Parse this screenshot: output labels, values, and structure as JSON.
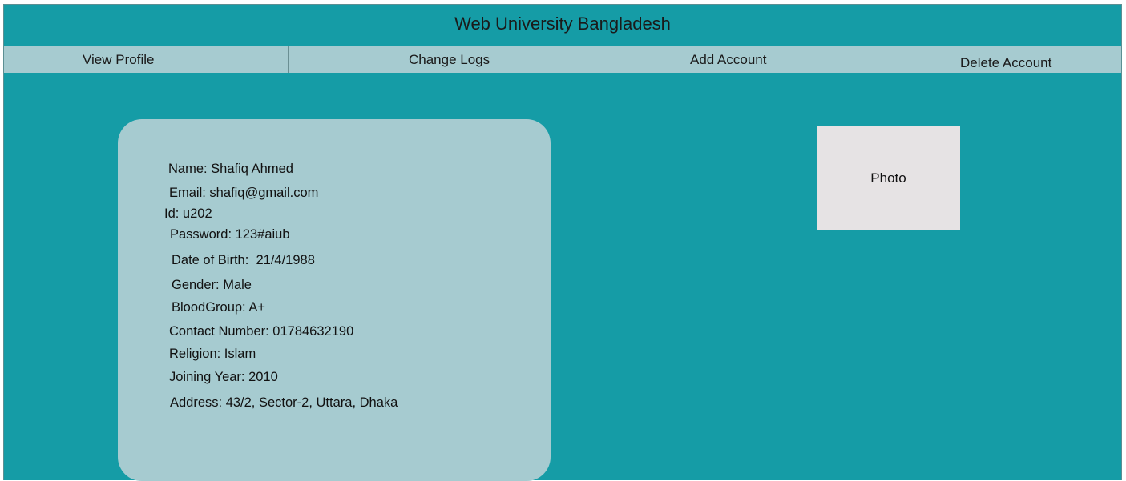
{
  "header": {
    "title": "Web University Bangladesh"
  },
  "nav": {
    "items": [
      {
        "label": "View Profile"
      },
      {
        "label": "Change Logs"
      },
      {
        "label": "Add Account"
      },
      {
        "label": "Delete Account"
      }
    ]
  },
  "profile": {
    "fields": [
      {
        "text": "Name: Shafiq Ahmed"
      },
      {
        "text": "Email: shafiq@gmail.com"
      },
      {
        "text": "Id: u202"
      },
      {
        "text": "Password: 123#aiub"
      },
      {
        "text": "Date of Birth:  21/4/1988"
      },
      {
        "text": "Gender: Male"
      },
      {
        "text": "BloodGroup: A+"
      },
      {
        "text": "Contact Number: 01784632190"
      },
      {
        "text": "Religion: Islam"
      },
      {
        "text": "Joining Year: 2010"
      },
      {
        "text": "Address: 43/2, Sector-2, Uttara, Dhaka"
      }
    ]
  },
  "photo": {
    "label": "Photo"
  },
  "colors": {
    "background": "#159ca6",
    "nav_bar": "#a6cbd0",
    "card": "#a6cbd0",
    "photo_box": "#e6e3e4"
  }
}
